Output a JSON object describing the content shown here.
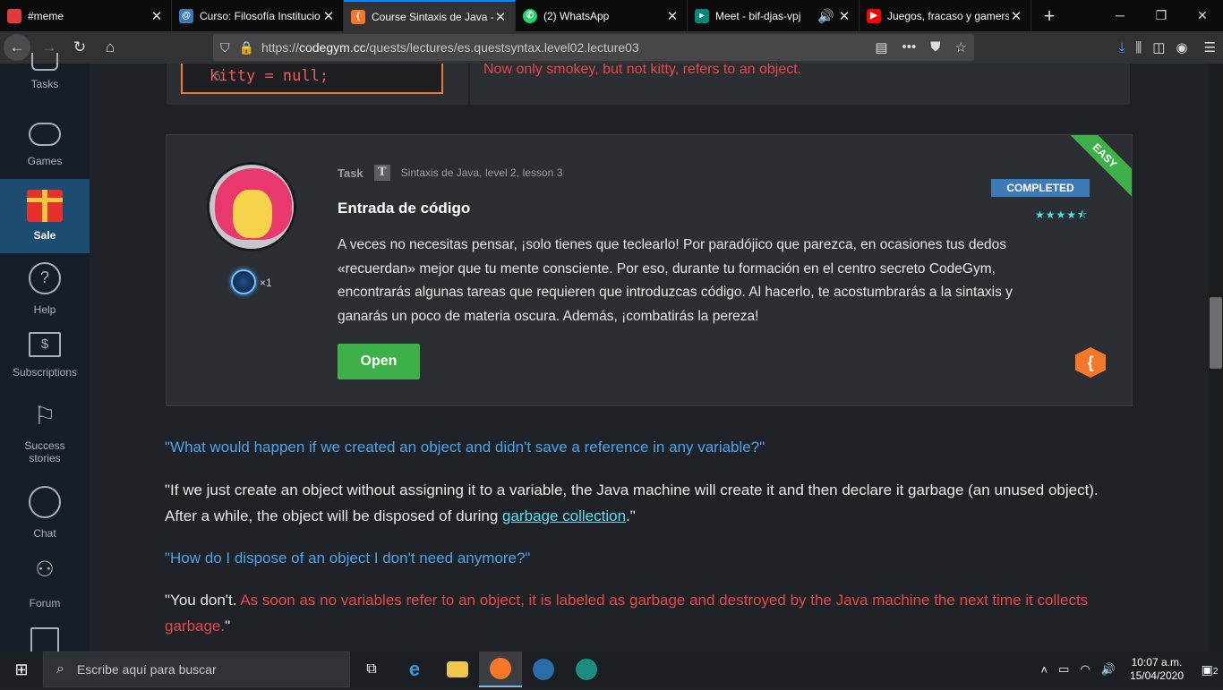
{
  "browser": {
    "tabs": [
      {
        "title": "#meme",
        "color": "#e03c3c"
      },
      {
        "title": "Curso: Filosofía Institucio",
        "color": "#3d7ab8"
      },
      {
        "title": "Course Sintaxis de Java -",
        "color": "#f7772a"
      },
      {
        "title": "(2) WhatsApp",
        "color": "#25d366"
      },
      {
        "title": "Meet - bif-djas-vpj",
        "color": "#00897b"
      },
      {
        "title": "Juegos, fracaso y gamers",
        "color": "#ff0000"
      }
    ],
    "url_prefix": "https://",
    "url_domain": "codegym.cc",
    "url_path": "/quests/lectures/es.questsyntax.level02.lecture03"
  },
  "sidebar": {
    "items": [
      {
        "label": "Tasks",
        "icon": "tasks-icon"
      },
      {
        "label": "Games",
        "icon": "gamepad-icon"
      },
      {
        "label": "Sale",
        "icon": "gift-icon"
      },
      {
        "label": "Help",
        "icon": "help-chat-icon"
      },
      {
        "label": "Subscriptions",
        "icon": "money-icon"
      },
      {
        "label": "Success",
        "label2": "stories",
        "icon": "flag-icon"
      },
      {
        "label": "Chat",
        "icon": "chat-icon"
      },
      {
        "label": "Forum",
        "icon": "people-icon"
      }
    ]
  },
  "code": {
    "line_number": "6",
    "line": "kitty = null;",
    "explanation": "Now only smokey, but not kitty, refers to an object."
  },
  "task": {
    "type": "Task",
    "badge": "T",
    "course": "Sintaxis de Java,",
    "level": "level 2,",
    "lesson": "lesson 3",
    "title": "Entrada de código",
    "description": "A veces no necesitas pensar, ¡solo tienes que teclearlo! Por paradójico que parezca, en ocasiones tus dedos «recuerdan» mejor que tu mente consciente. Por eso, durante tu formación en el centro secreto CodeGym, encontrarás algunas tareas que requieren que introduzcas código. Al hacerlo, te acostumbrarás a la sintaxis y ganarás un poco de materia oscura. Además, ¡combatirás la pereza!",
    "open_label": "Open",
    "status": "COMPLETED",
    "difficulty": "EASY",
    "rating": "★★★★⯪",
    "reward_count": "×1"
  },
  "lecture": {
    "q1": "\"What would happen if we created an object and didn't save a reference in any variable?\"",
    "a1_start": "\"If we just create an object without assigning it to a variable, the Java machine will create it and then declare it garbage (an unused object). After a while, the object will be disposed of during ",
    "a1_link": "garbage collection",
    "a1_end": ".\"",
    "q2": "\"How do I dispose of an object I don't need anymore?\"",
    "a2_start": "\"You don't. ",
    "a2_red": "As soon as no variables refer to an object, it is labeled as garbage and destroyed by the Java machine the next time it collects garbage.",
    "a2_end": "\""
  },
  "taskbar": {
    "search_placeholder": "Escribe aquí para buscar",
    "time": "10:07 a.m.",
    "date": "15/04/2020",
    "notifications": "2"
  }
}
